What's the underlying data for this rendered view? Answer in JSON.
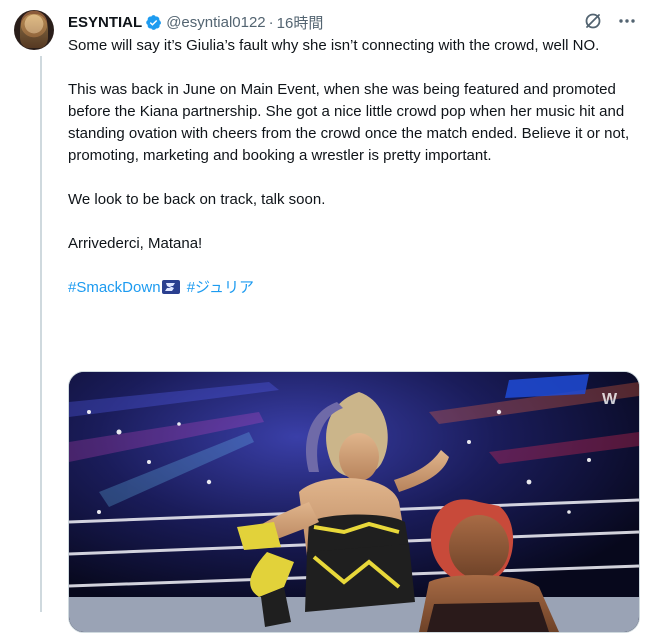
{
  "tweet": {
    "display_name": "ESYNTIAL",
    "handle": "@esyntial0122",
    "separator": "·",
    "time": "16時間",
    "paragraphs": [
      "Some will say it’s Giulia’s fault why she isn’t connecting with the crowd, well NO.",
      "This was back in June on Main Event, when she was being featured and promoted before the Kiana partnership. She got a nice little crowd pop when her music hit and standing ovation with cheers from the crowd once the match ended. Believe it or not, promoting, marketing and booking a wrestler is pretty important.",
      "We look to be back on track, talk soon.",
      "Arrivederci, Matana!"
    ],
    "hashtags": [
      "#SmackDown",
      "#ジュリア"
    ],
    "media_watermark": "W"
  },
  "icons": {
    "verified": "verified-badge-icon",
    "grok": "grok-icon",
    "more": "more-icon",
    "smackdown_emoji": "smackdown-emoji-icon"
  },
  "colors": {
    "link": "#1d9bf0",
    "secondary_text": "#536471",
    "verified": "#1d9bf0",
    "border": "#cfd9de"
  }
}
